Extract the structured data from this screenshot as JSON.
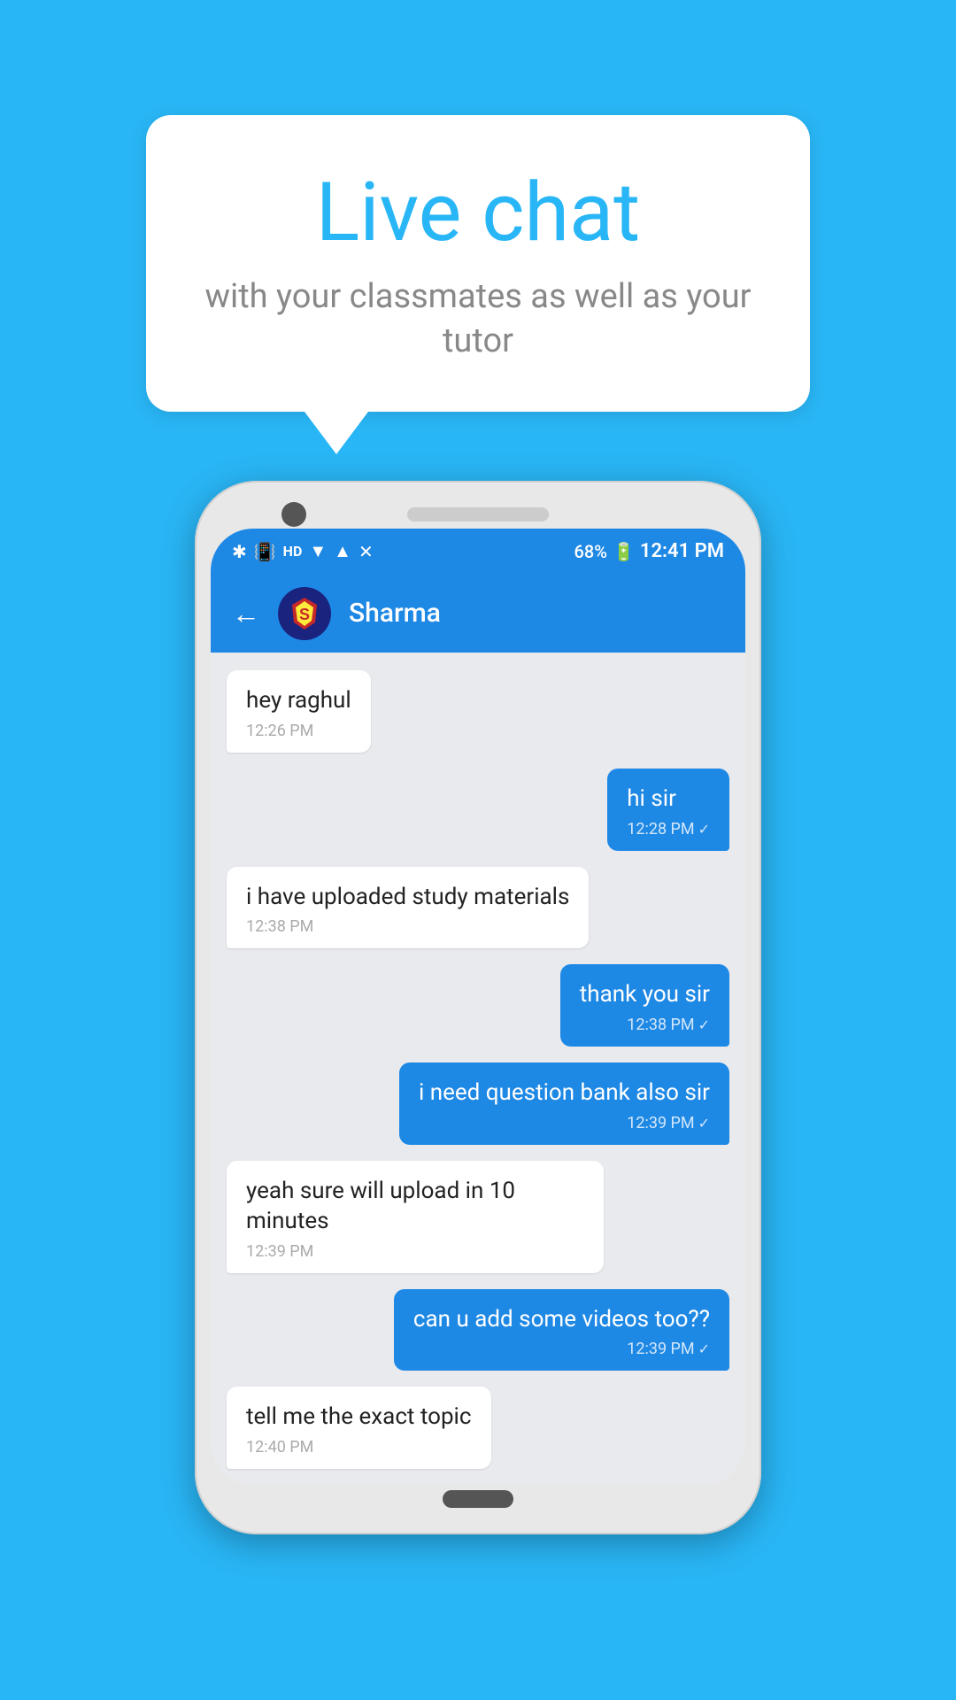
{
  "background_color": "#29b6f6",
  "bubble": {
    "title": "Live chat",
    "subtitle": "with your classmates as well as your tutor"
  },
  "status_bar": {
    "time": "12:41 PM",
    "battery": "68%",
    "signal_icons": "🔷 📳 HD ▲▼ ▲"
  },
  "app_header": {
    "contact_name": "Sharma",
    "back_label": "←"
  },
  "messages": [
    {
      "id": 1,
      "type": "received",
      "text": "hey raghul",
      "time": "12:26 PM",
      "check": false
    },
    {
      "id": 2,
      "type": "sent",
      "text": "hi sir",
      "time": "12:28 PM",
      "check": true
    },
    {
      "id": 3,
      "type": "received",
      "text": "i have uploaded study materials",
      "time": "12:38 PM",
      "check": false
    },
    {
      "id": 4,
      "type": "sent",
      "text": "thank you sir",
      "time": "12:38 PM",
      "check": true
    },
    {
      "id": 5,
      "type": "sent",
      "text": "i need question bank also sir",
      "time": "12:39 PM",
      "check": true
    },
    {
      "id": 6,
      "type": "received",
      "text": "yeah sure will upload in 10 minutes",
      "time": "12:39 PM",
      "check": false
    },
    {
      "id": 7,
      "type": "sent",
      "text": "can u add some videos too??",
      "time": "12:39 PM",
      "check": true
    },
    {
      "id": 8,
      "type": "received",
      "text": "tell me the exact topic",
      "time": "12:40 PM",
      "check": false
    }
  ]
}
